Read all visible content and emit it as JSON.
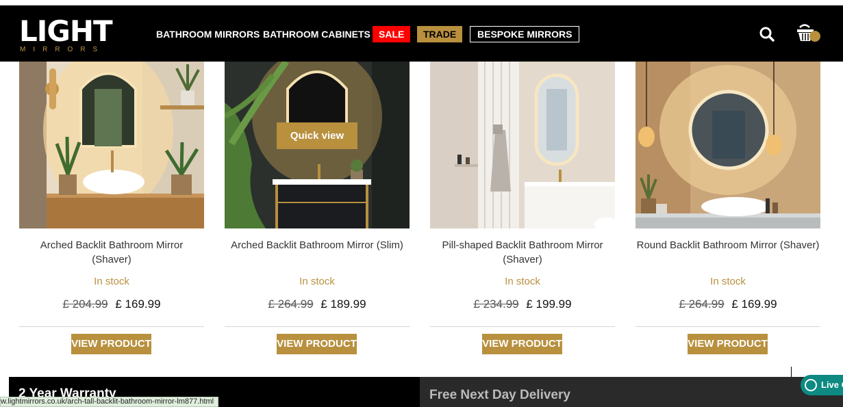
{
  "brand": {
    "logo_main": "LIGHT",
    "logo_sub": "MIRRORS"
  },
  "nav": {
    "items": [
      "BATHROOM MIRRORS",
      "BATHROOM CABINETS"
    ],
    "sale": "SALE",
    "trade": "TRADE",
    "bespoke": "BESPOKE MIRRORS"
  },
  "header_icons": {
    "search": "search-icon",
    "basket": "basket-icon"
  },
  "products": [
    {
      "title": "Arched Backlit Bathroom Mirror (Shaver)",
      "stock": "In stock",
      "old_price": "£ 204.99",
      "price": "£ 169.99",
      "button": "VIEW PRODUCT"
    },
    {
      "title": "Arched Backlit Bathroom Mirror (Slim)",
      "stock": "In stock",
      "old_price": "£ 264.99",
      "price": "£ 189.99",
      "button": "VIEW PRODUCT",
      "quick_view": "Quick view"
    },
    {
      "title": "Pill-shaped Backlit Bathroom Mirror (Shaver)",
      "stock": "In stock",
      "old_price": "£ 234.99",
      "price": "£ 199.99",
      "button": "VIEW PRODUCT"
    },
    {
      "title": "Round Backlit Bathroom Mirror (Shaver)",
      "stock": "In stock",
      "old_price": "£ 264.99",
      "price": "£ 169.99",
      "button": "VIEW PRODUCT"
    }
  ],
  "banners": {
    "warranty": "2 Year Warranty",
    "delivery": "Free Next Day Delivery"
  },
  "status_bar": {
    "url": "w.lightmirrors.co.uk/arch-tall-backlit-bathroom-mirror-lm877.html"
  },
  "live_chat": {
    "label": "Live C"
  },
  "colors": {
    "accent_gold": "#b8903e",
    "sale_red": "#ff0000",
    "header_bg": "#000000",
    "chat_teal": "#0d8a82"
  }
}
